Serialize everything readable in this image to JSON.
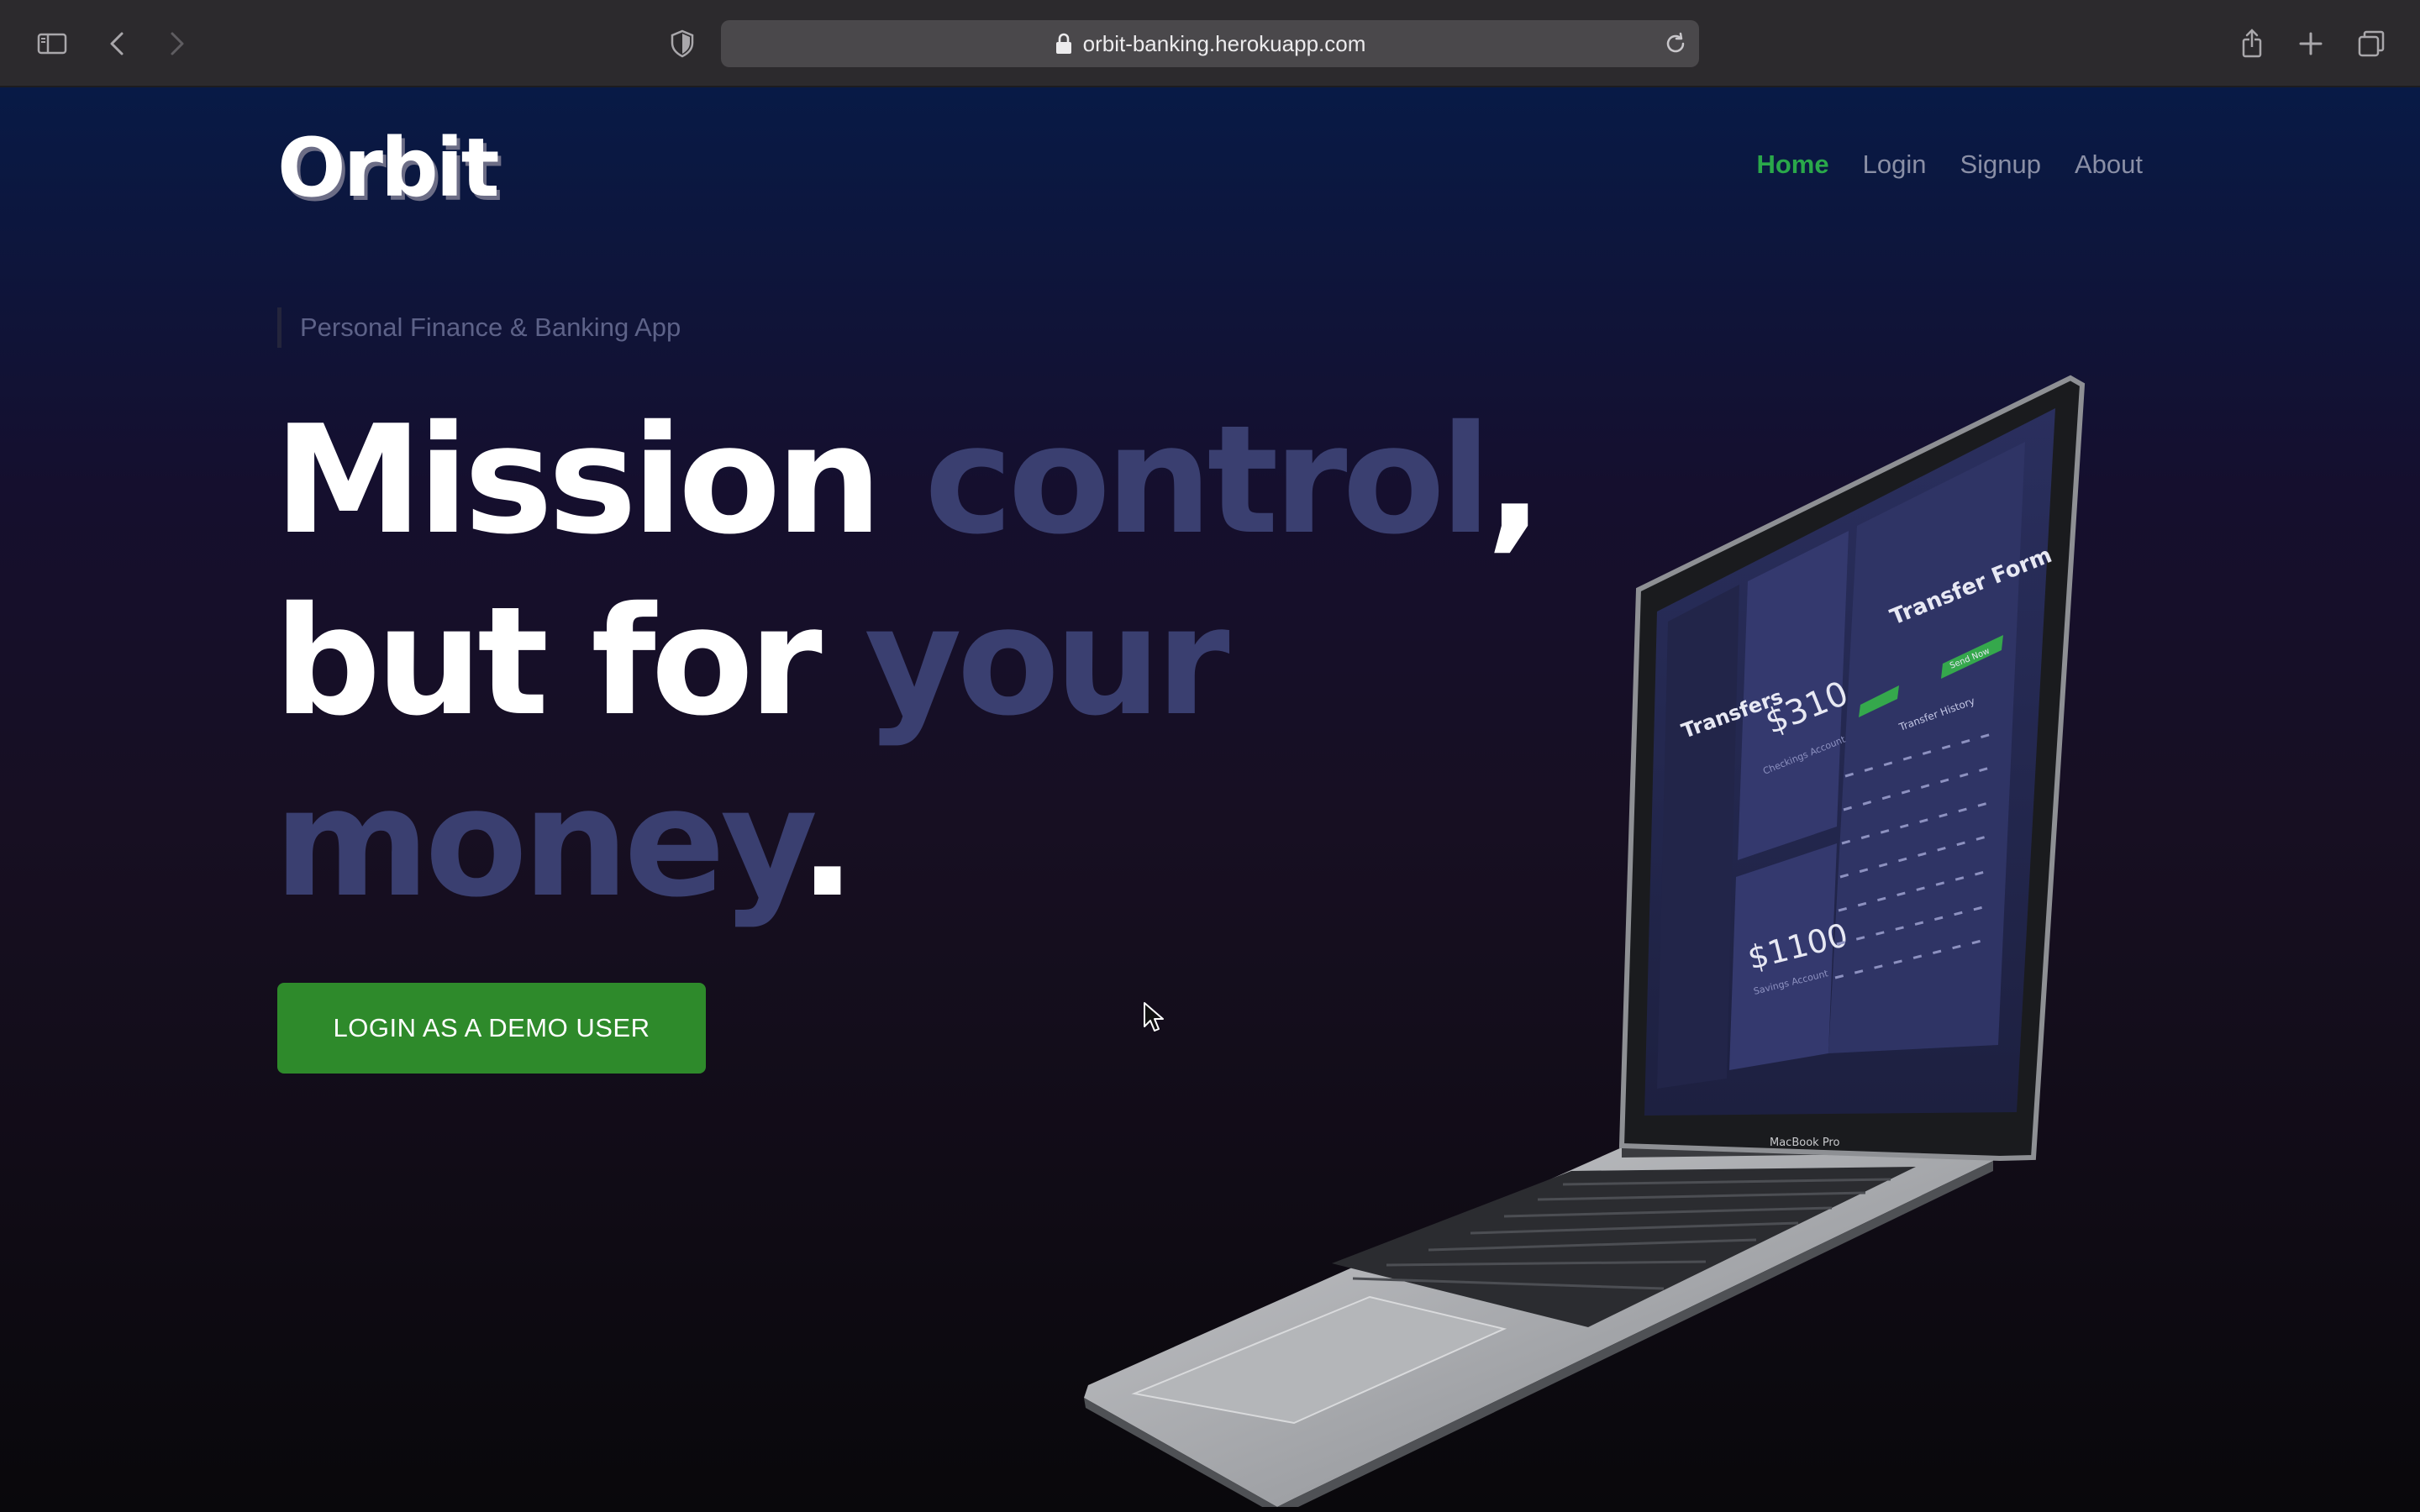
{
  "browser": {
    "url": "orbit-banking.herokuapp.com",
    "icons": [
      "sidebar-icon",
      "back-icon",
      "forward-icon",
      "shield-icon",
      "lock-icon",
      "reload-icon",
      "share-icon",
      "new-tab-icon",
      "tabs-overview-icon"
    ]
  },
  "site": {
    "logo": "Orbit",
    "nav": {
      "home": "Home",
      "login": "Login",
      "signup": "Signup",
      "about": "About"
    },
    "tagline": "Personal Finance & Banking App",
    "headline": {
      "w1": "Mission",
      "w2": "control",
      "w3": ",",
      "w4": "but for",
      "w5": "your",
      "w6": "money",
      "w7": "."
    },
    "cta": "LOGIN AS A DEMO USER"
  },
  "laptop_screen": {
    "sidebar_title": "Transfers",
    "checking_amount": "$310",
    "checking_label": "Checkings Account",
    "savings_amount": "$1100",
    "savings_label": "Savings Account",
    "form_title": "Transfer Form",
    "send_button": "Send Now",
    "history_title": "Transfer History",
    "brand": "MacBook Pro"
  },
  "colors": {
    "accent_green": "#2e8a2b",
    "nav_active": "#2aa84a",
    "headline_muted": "#3a3f70"
  }
}
